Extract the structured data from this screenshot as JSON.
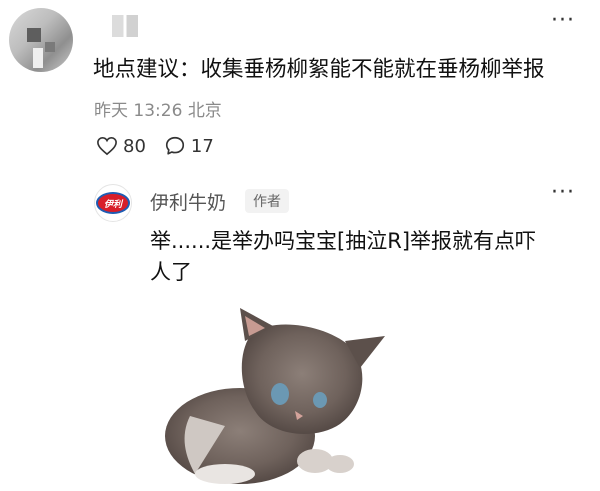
{
  "comment": {
    "text": "地点建议：收集垂杨柳絮能不能就在垂杨柳举报",
    "time": "昨天 13:26",
    "location": "北京",
    "likes": "80",
    "replies": "17"
  },
  "reply": {
    "name": "伊利牛奶",
    "author_tag": "作者",
    "avatar_logo": "伊利",
    "text": "举......是举办吗宝宝[抽泣R]举报就有点吓人了"
  },
  "more_label": "···"
}
